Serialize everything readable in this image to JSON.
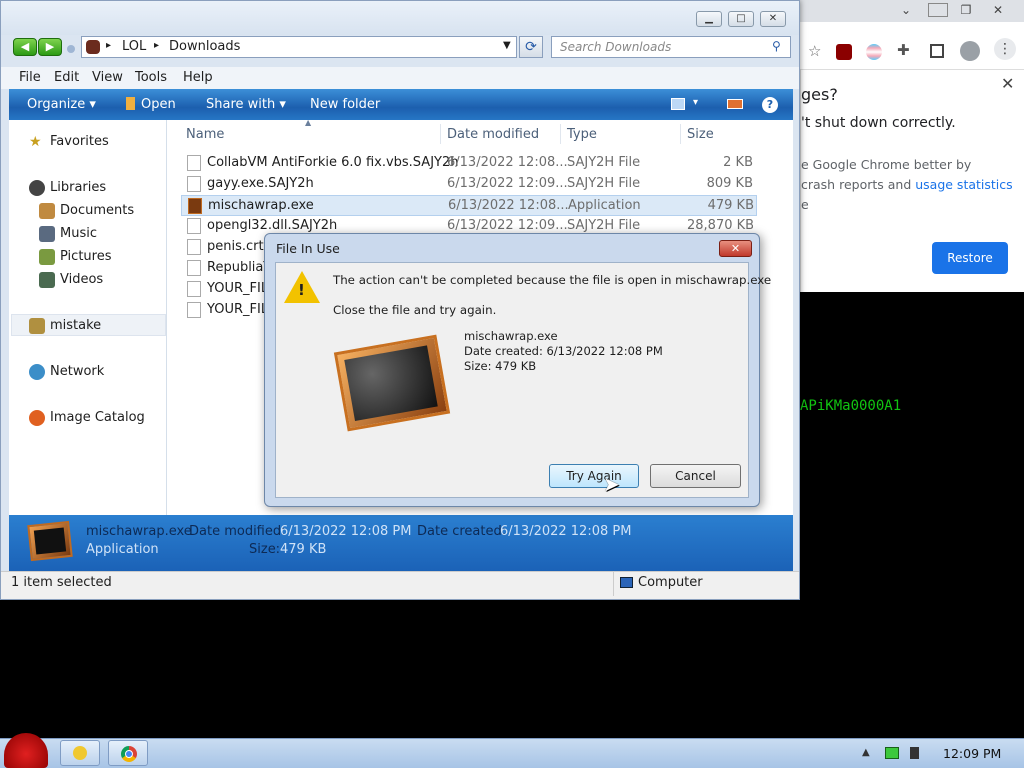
{
  "chrome": {
    "popup_title": "ges?",
    "popup_line1": "'t shut down correctly.",
    "popup_line2": "e Google Chrome better by",
    "popup_line3a": "crash reports and ",
    "popup_line3b": "usage statistics",
    "popup_line4": "e",
    "restore_label": "Restore"
  },
  "terminal_text": "APiKMa0000A1",
  "explorer": {
    "breadcrumb": [
      "LOL",
      "Downloads"
    ],
    "search_placeholder": "Search Downloads",
    "menu": [
      "File",
      "Edit",
      "View",
      "Tools",
      "Help"
    ],
    "commands": [
      "Organize",
      "Open",
      "Share with",
      "New folder"
    ],
    "nav": {
      "favorites": "Favorites",
      "libraries": "Libraries",
      "documents": "Documents",
      "music": "Music",
      "pictures": "Pictures",
      "videos": "Videos",
      "user": "mistake",
      "network": "Network",
      "image_catalog": "Image Catalog"
    },
    "columns": {
      "name": "Name",
      "date": "Date modified",
      "type": "Type",
      "size": "Size"
    },
    "files": [
      {
        "name": "CollabVM AntiForkie 6.0 fix.vbs.SAJY2h",
        "date": "6/13/2022 12:08...",
        "type": "SAJY2H File",
        "size": "2 KB"
      },
      {
        "name": "gayy.exe.SAJY2h",
        "date": "6/13/2022 12:09...",
        "type": "SAJY2H File",
        "size": "809 KB"
      },
      {
        "name": "mischawrap.exe",
        "date": "6/13/2022 12:08...",
        "type": "Application",
        "size": "479 KB"
      },
      {
        "name": "opengl32.dll.SAJY2h",
        "date": "6/13/2022 12:09...",
        "type": "SAJY2H File",
        "size": "28,870 KB"
      },
      {
        "name": "penis.crt.S",
        "date": "",
        "type": "",
        "size": ""
      },
      {
        "name": "RepubliaT",
        "date": "",
        "type": "",
        "size": ""
      },
      {
        "name": "YOUR_FILE",
        "date": "",
        "type": "",
        "size": ""
      },
      {
        "name": "YOUR_FILE",
        "date": "",
        "type": "",
        "size": ""
      }
    ],
    "details": {
      "name": "mischawrap.exe",
      "type": "Application",
      "modified_label": "Date modified:",
      "modified": "6/13/2022 12:08 PM",
      "created_label": "Date created:",
      "created": "6/13/2022 12:08 PM",
      "size_label": "Size:",
      "size": "479 KB"
    },
    "status": "1 item selected",
    "status_right": "Computer"
  },
  "dialog": {
    "title": "File In Use",
    "message": "The action can't be completed because the file is open in mischawrap.exe",
    "hint": "Close the file and try again.",
    "file_name": "mischawrap.exe",
    "file_created": "Date created: 6/13/2022 12:08 PM",
    "file_size": "Size: 479 KB",
    "try_again": "Try Again",
    "cancel": "Cancel"
  },
  "taskbar": {
    "clock": "12:09 PM"
  }
}
